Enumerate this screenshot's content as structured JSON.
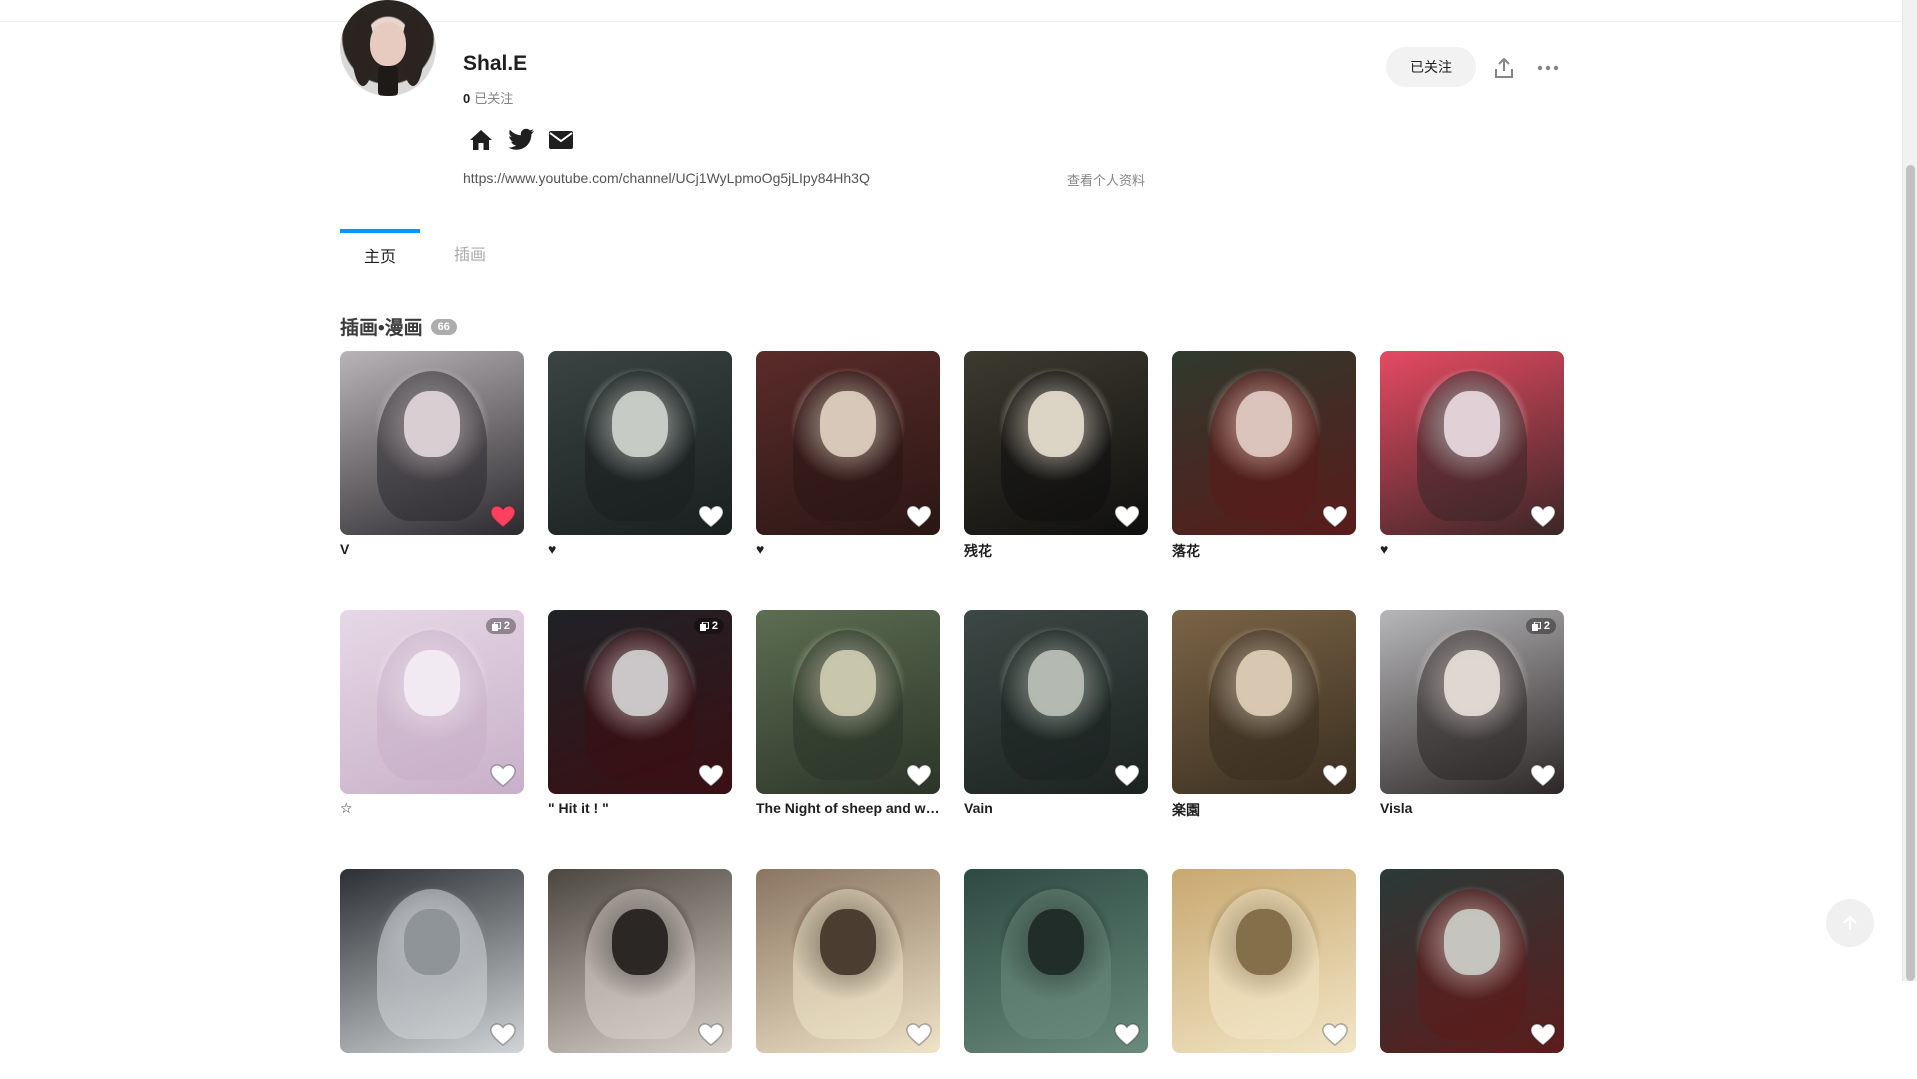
{
  "profile": {
    "username": "Shal.E",
    "following_count": "0",
    "following_label": "已关注",
    "url": "https://www.youtube.com/channel/UCj1WyLpmoOg5jLIpy84Hh3Q",
    "view_profile": "查看个人资料",
    "follow_button": "已关注",
    "social_icons": [
      "home-icon",
      "twitter-icon",
      "mail-icon"
    ]
  },
  "tabs": [
    {
      "label": "主页",
      "active": true
    },
    {
      "label": "插画",
      "active": false
    }
  ],
  "section": {
    "title": "插画•漫画",
    "count": "66"
  },
  "colors": {
    "accent": "#0096fa",
    "liked": "#ff4060"
  },
  "artworks": [
    {
      "title": "V",
      "liked": true,
      "pages": ""
    },
    {
      "title": "♥",
      "liked": false,
      "pages": ""
    },
    {
      "title": "♥",
      "liked": false,
      "pages": ""
    },
    {
      "title": "残花",
      "liked": false,
      "pages": ""
    },
    {
      "title": "落花",
      "liked": false,
      "pages": ""
    },
    {
      "title": "♥",
      "liked": false,
      "pages": ""
    },
    {
      "title": "☆",
      "liked": false,
      "pages": "2"
    },
    {
      "title": "\" Hit it ! \"",
      "liked": false,
      "pages": "2"
    },
    {
      "title": "The Night of sheep and wolves",
      "liked": false,
      "pages": ""
    },
    {
      "title": "Vain",
      "liked": false,
      "pages": ""
    },
    {
      "title": "楽園",
      "liked": false,
      "pages": ""
    },
    {
      "title": "Visla",
      "liked": false,
      "pages": "2"
    },
    {
      "title": "",
      "liked": false,
      "pages": ""
    },
    {
      "title": "",
      "liked": false,
      "pages": ""
    },
    {
      "title": "",
      "liked": false,
      "pages": ""
    },
    {
      "title": "",
      "liked": false,
      "pages": ""
    },
    {
      "title": "",
      "liked": false,
      "pages": ""
    },
    {
      "title": "",
      "liked": false,
      "pages": ""
    }
  ]
}
